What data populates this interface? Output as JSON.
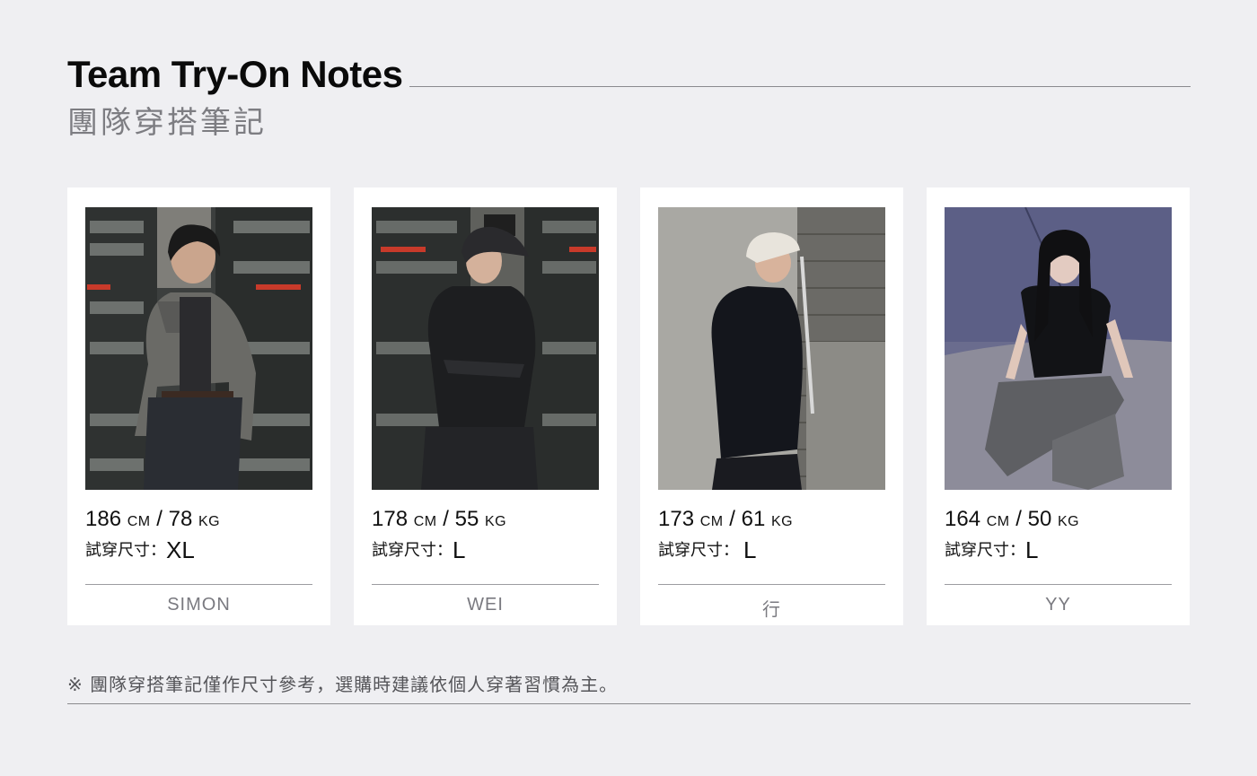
{
  "header": {
    "title": "Team Try-On Notes",
    "subtitle": "團隊穿搭筆記"
  },
  "cards": [
    {
      "height": "186",
      "height_unit": "CM",
      "weight": "78",
      "weight_unit": "KG",
      "size_label": "試穿尺寸：",
      "size_value": "XL",
      "name": "SIMON",
      "photo": "man-in-plaid-shirt-photo"
    },
    {
      "height": "178",
      "height_unit": "CM",
      "weight": "55",
      "weight_unit": "KG",
      "size_label": "試穿尺寸：",
      "size_value": "L",
      "name": "WEI",
      "photo": "person-in-black-cap-and-jacket-photo"
    },
    {
      "height": "173",
      "height_unit": "CM",
      "weight": "61",
      "weight_unit": "KG",
      "size_label": "試穿尺寸：",
      "size_value": "L",
      "name": "行",
      "photo": "man-in-black-hoodie-photo"
    },
    {
      "height": "164",
      "height_unit": "CM",
      "weight": "50",
      "weight_unit": "KG",
      "size_label": "試穿尺寸：",
      "size_value": "L",
      "name": "YY",
      "photo": "woman-sitting-in-denim-photo"
    }
  ],
  "footer": {
    "note": "※ 團隊穿搭筆記僅作尺寸參考，選購時建議依個人穿著習慣為主。"
  }
}
